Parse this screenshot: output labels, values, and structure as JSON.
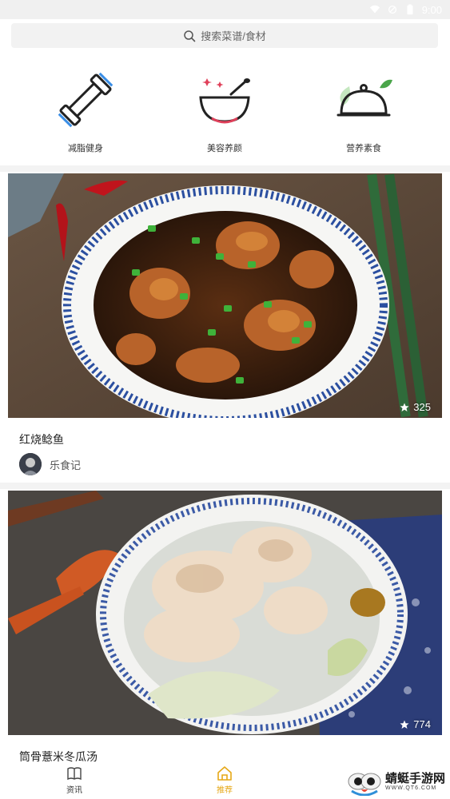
{
  "status_bar": {
    "time": "9:00"
  },
  "search": {
    "placeholder": "搜索菜谱/食材"
  },
  "categories": [
    {
      "label": "减脂健身",
      "icon": "dumbbell-icon"
    },
    {
      "label": "美容养颜",
      "icon": "bowl-icon"
    },
    {
      "label": "营养素食",
      "icon": "cloche-icon"
    }
  ],
  "recipes": [
    {
      "title": "红烧鲶鱼",
      "author": "乐食记",
      "likes": "325"
    },
    {
      "title": "筒骨薏米冬瓜汤",
      "likes": "774"
    }
  ],
  "bottom_nav": [
    {
      "label": "资讯",
      "icon": "book-icon",
      "active": false
    },
    {
      "label": "推荐",
      "icon": "home-icon",
      "active": true
    }
  ],
  "watermark": {
    "text": "蜻蜓手游网",
    "url": "WWW.QT6.COM"
  },
  "colors": {
    "accent": "#e6a817",
    "active_nav": "#e6a817",
    "icon_blue": "#3a8ee6",
    "icon_red": "#e0405a"
  }
}
